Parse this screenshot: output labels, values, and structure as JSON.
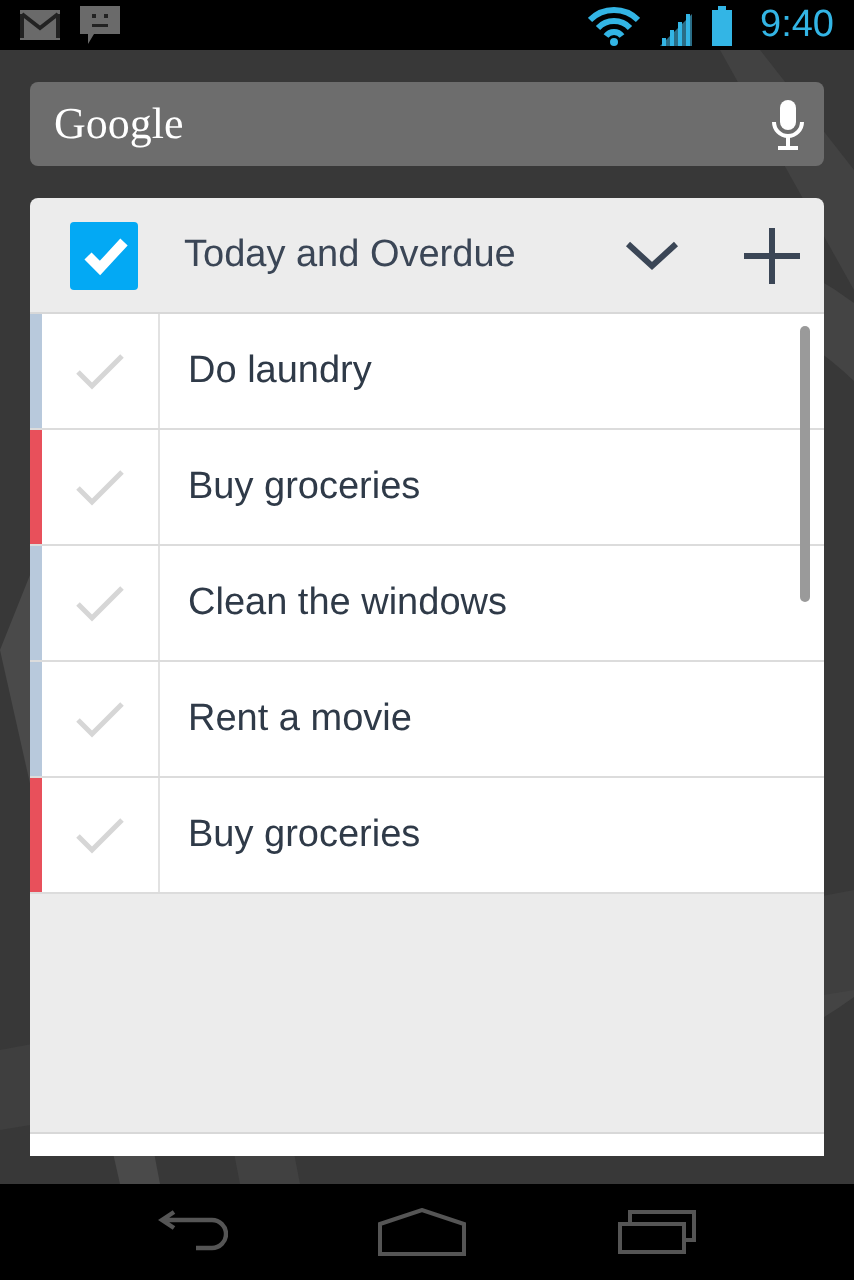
{
  "status_bar": {
    "time": "9:40"
  },
  "search": {
    "label": "Google"
  },
  "widget": {
    "title": "Today and Overdue",
    "tasks": [
      {
        "text": "Do laundry",
        "checked": false,
        "color": "#b8c9dc"
      },
      {
        "text": "Buy groceries",
        "checked": false,
        "color": "#e8505b"
      },
      {
        "text": "Clean the windows",
        "checked": false,
        "color": "#b8c9dc"
      },
      {
        "text": "Rent a movie",
        "checked": false,
        "color": "#b8c9dc"
      },
      {
        "text": "Buy groceries",
        "checked": false,
        "color": "#e8505b"
      }
    ]
  }
}
